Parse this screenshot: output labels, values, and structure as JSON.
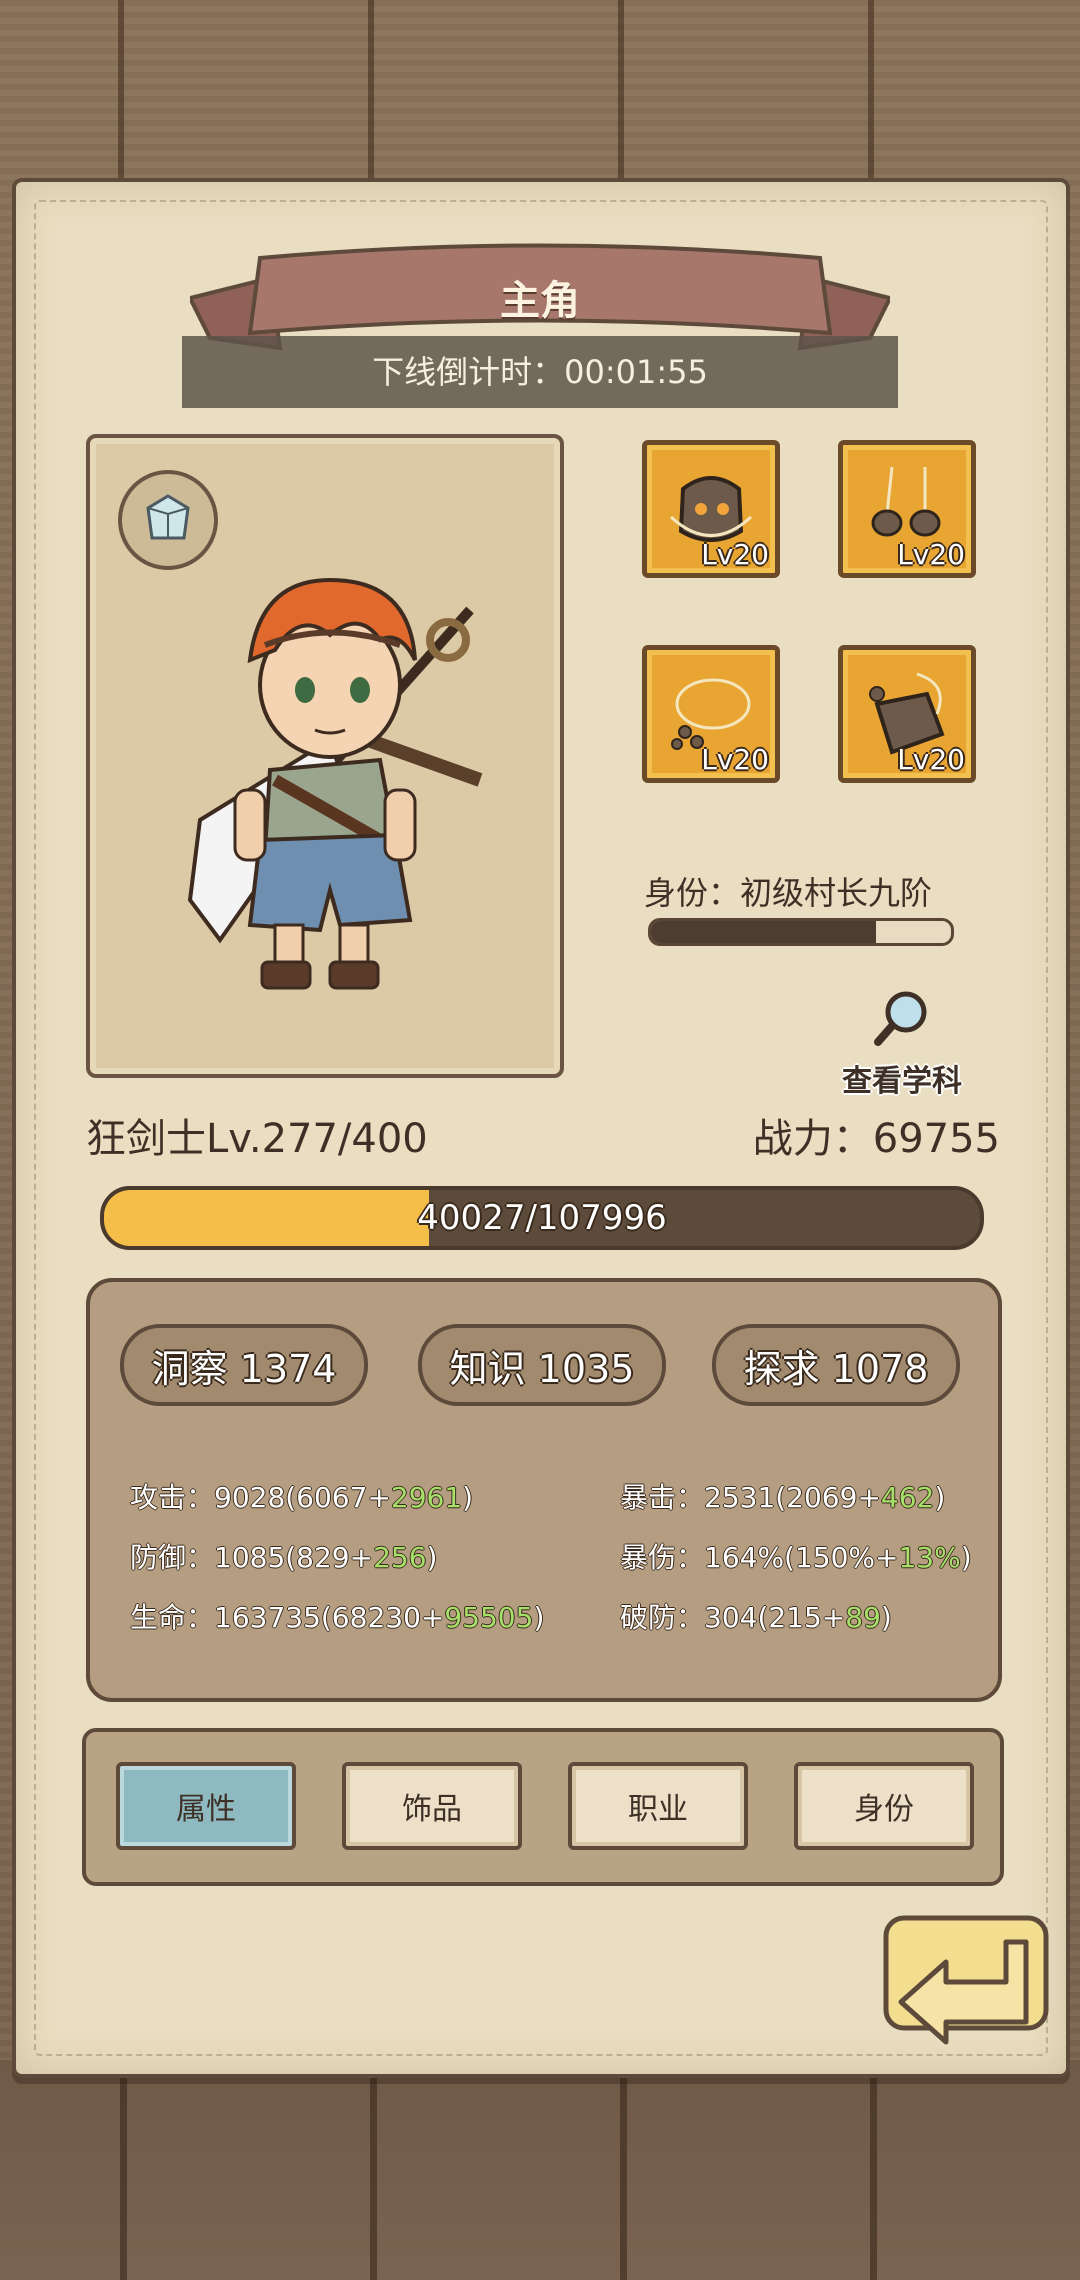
{
  "header": {
    "title": "主角",
    "countdown_label": "下线倒计时：00:01:55"
  },
  "character": {
    "class_level": "狂剑士Lv.277/400",
    "power_label": "战力：69755",
    "exp_text": "40027/107996",
    "exp_progress": 0.3706
  },
  "equipment": [
    {
      "name": "rock-helmet-icon",
      "level": "Lv20"
    },
    {
      "name": "rock-earring-icon",
      "level": "Lv20"
    },
    {
      "name": "rock-necklace-icon",
      "level": "Lv20"
    },
    {
      "name": "rock-bracer-icon",
      "level": "Lv20"
    }
  ],
  "identity": {
    "label": "身份：初级村长九阶",
    "progress": 0.75,
    "view_subject_label": "查看学科"
  },
  "attributes": {
    "insight": "洞察 1374",
    "knowledge": "知识 1035",
    "explore": "探求 1078"
  },
  "stats": {
    "attack_label": "攻击：9028(6067+",
    "attack_bonus": "2961",
    "defense_label": "防御：1085(829+",
    "defense_bonus": "256",
    "hp_label": "生命：163735(68230+",
    "hp_bonus": "95505",
    "crit_label": "暴击：2531(2069+",
    "crit_bonus": "462",
    "critdmg_label": "暴伤：164%(150%+",
    "critdmg_bonus": "13%",
    "pierce_label": "破防：304(215+",
    "pierce_bonus": "89",
    "close_paren": ")"
  },
  "tabs": {
    "attributes": "属性",
    "accessories": "饰品",
    "profession": "职业",
    "identity": "身份",
    "active": "attributes"
  },
  "colors": {
    "parchment": "#e9dec1",
    "ribbon": "#a8776c",
    "exp_fill": "#f5be49",
    "bonus_green": "#a6e06a",
    "tab_active": "#8fb9c0"
  }
}
